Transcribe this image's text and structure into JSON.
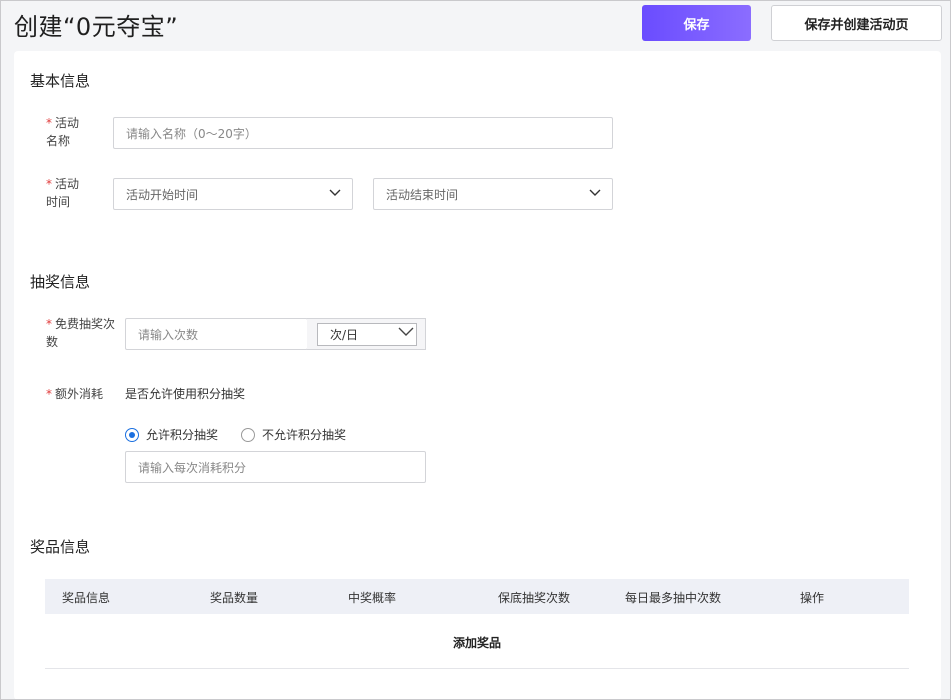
{
  "header": {
    "title": "创建“0元夺宝”",
    "save_label": "保存",
    "save_create_label": "保存并创建活动页"
  },
  "basic": {
    "title": "基本信息",
    "name_label_1": "活动",
    "name_label_2": "名称",
    "name_placeholder": "请输入名称（0～20字）",
    "time_label_1": "活动",
    "time_label_2": "时间",
    "start_placeholder": "活动开始时间",
    "end_placeholder": "活动结束时间",
    "required_mark": "*"
  },
  "lottery": {
    "title": "抽奖信息",
    "free_label_1": "免费抽奖次",
    "free_label_2": "数",
    "free_placeholder": "请输入次数",
    "unit_value": "次/日",
    "extra_label": "额外消耗",
    "extra_question": "是否允许使用积分抽奖",
    "allow_label": "允许积分抽奖",
    "disallow_label": "不允许积分抽奖",
    "allow_selected": true,
    "points_placeholder": "请输入每次消耗积分"
  },
  "prize": {
    "title": "奖品信息",
    "columns": [
      "奖品信息",
      "奖品数量",
      "中奖概率",
      "保底抽奖次数",
      "每日最多抽中次数",
      "操作"
    ],
    "add_label": "添加奖品"
  },
  "colors": {
    "accent": "#6a4cff",
    "radio": "#1a6fe0",
    "required": "#e03b3b"
  }
}
